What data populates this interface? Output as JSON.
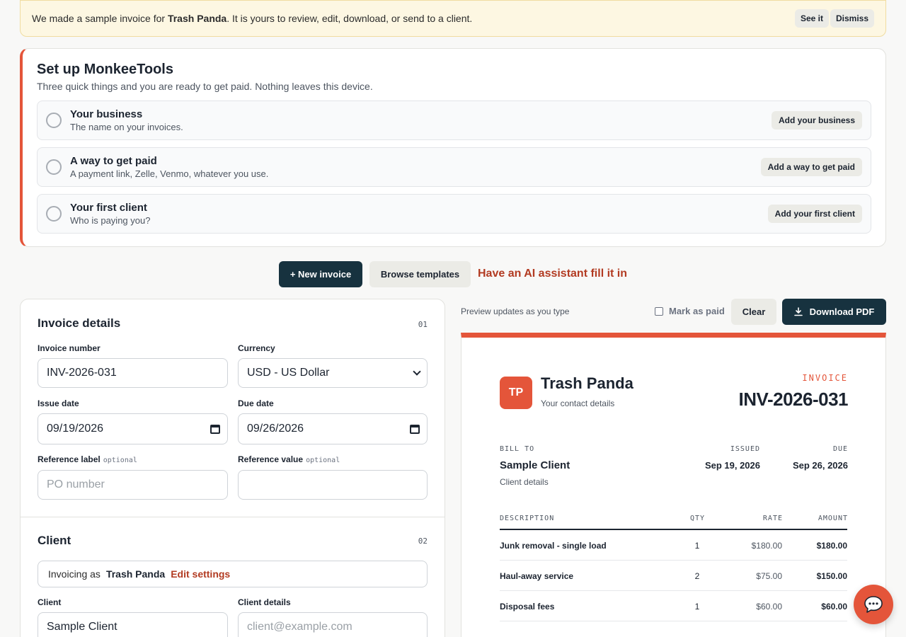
{
  "banner": {
    "text_before": "We made a sample invoice for ",
    "business": "Trash Panda",
    "text_after": ". It is yours to review, edit, download, or send to a client.",
    "see_it": "See it",
    "dismiss": "Dismiss"
  },
  "setup": {
    "title": "Set up MonkeeTools",
    "subtitle": "Three quick things and you are ready to get paid. Nothing leaves this device.",
    "steps": [
      {
        "title": "Your business",
        "desc": "The name on your invoices.",
        "action": "Add your business"
      },
      {
        "title": "A way to get paid",
        "desc": "A payment link, Zelle, Venmo, whatever you use.",
        "action": "Add a way to get paid"
      },
      {
        "title": "Your first client",
        "desc": "Who is paying you?",
        "action": "Add your first client"
      }
    ]
  },
  "actions": {
    "new_invoice": "+ New invoice",
    "browse_templates": "Browse templates",
    "ai_fill": "Have an AI assistant fill it in"
  },
  "form": {
    "details": {
      "title": "Invoice details",
      "num": "01",
      "invoice_number_label": "Invoice number",
      "invoice_number": "INV-2026-031",
      "currency_label": "Currency",
      "currency": "USD - US Dollar",
      "issue_date_label": "Issue date",
      "issue_date": "09/19/2026",
      "due_date_label": "Due date",
      "due_date": "09/26/2026",
      "ref_label": "Reference label",
      "ref_value_label": "Reference value",
      "optional": "optional",
      "ref_label_placeholder": "PO number",
      "ref_value": ""
    },
    "client": {
      "title": "Client",
      "num": "02",
      "invoicing_as": "Invoicing as",
      "business": "Trash Panda",
      "edit_settings": "Edit settings",
      "client_label": "Client",
      "client_value": "Sample Client",
      "details_label": "Client details",
      "details_placeholder": "client@example.com"
    }
  },
  "preview": {
    "hint": "Preview updates as you type",
    "mark_paid": "Mark as paid",
    "clear": "Clear",
    "download": "Download PDF",
    "logo_initials": "TP",
    "business": "Trash Panda",
    "contact": "Your contact details",
    "invoice_tag": "INVOICE",
    "invoice_number": "INV-2026-031",
    "bill_to_label": "BILL TO",
    "client_name": "Sample Client",
    "client_details": "Client details",
    "issued_label": "ISSUED",
    "issued": "Sep 19, 2026",
    "due_label": "DUE",
    "due": "Sep 26, 2026",
    "columns": {
      "description": "DESCRIPTION",
      "qty": "QTY",
      "rate": "RATE",
      "amount": "AMOUNT"
    },
    "items": [
      {
        "description": "Junk removal - single load",
        "qty": "1",
        "rate": "$180.00",
        "amount": "$180.00"
      },
      {
        "description": "Haul-away service",
        "qty": "2",
        "rate": "$75.00",
        "amount": "$150.00"
      },
      {
        "description": "Disposal fees",
        "qty": "1",
        "rate": "$60.00",
        "amount": "$60.00"
      }
    ]
  },
  "colors": {
    "accent": "#e4553a",
    "dark": "#17323f",
    "link": "#b23b22"
  },
  "icons": {
    "download": "download-icon",
    "chat": "chat-bubble-icon"
  }
}
